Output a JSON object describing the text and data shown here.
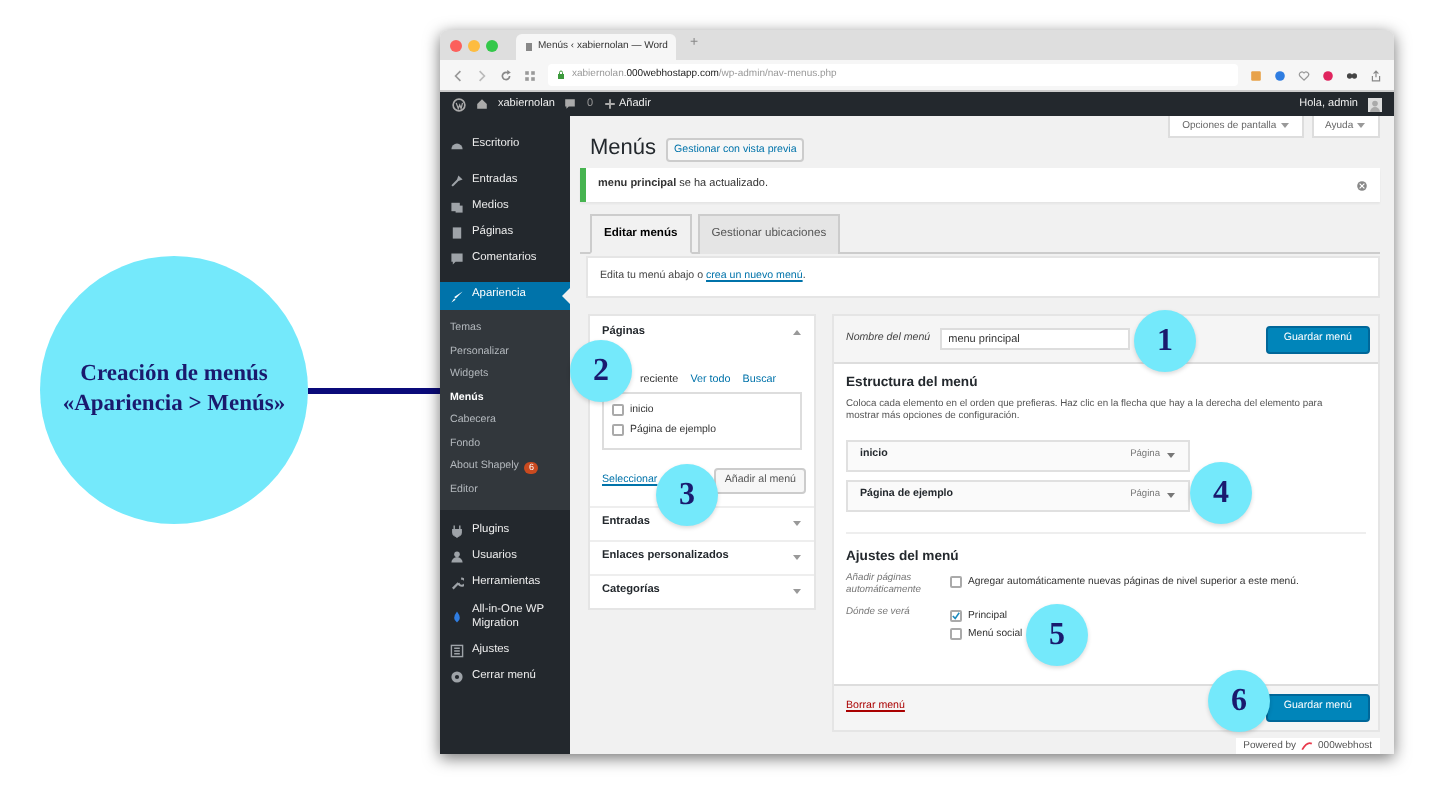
{
  "annotation": {
    "lines": [
      "Creación de menús",
      "«Apariencia > Menús»"
    ]
  },
  "callouts": [
    "1",
    "2",
    "3",
    "4",
    "5",
    "6"
  ],
  "browser": {
    "tab_title": "Menús ‹ xabiernolan — Word",
    "new_tab": "+",
    "url": "xabiernolan.**000webhostapp.com**/wp-admin/nav-menus.php"
  },
  "admin_bar": {
    "site": "xabiernolan",
    "comments": "0",
    "new": "Añadir",
    "greeting": "Hola, admin"
  },
  "sidebar": {
    "items": [
      {
        "label": "Escritorio",
        "selected": false
      },
      {
        "label": "Entradas",
        "selected": false
      },
      {
        "label": "Medios",
        "selected": false
      },
      {
        "label": "Páginas",
        "selected": false
      },
      {
        "label": "Comentarios",
        "selected": false
      },
      {
        "label": "Apariencia",
        "selected": true,
        "children": [
          {
            "label": "Temas",
            "selected": false
          },
          {
            "label": "Personalizar",
            "selected": false
          },
          {
            "label": "Widgets",
            "selected": false
          },
          {
            "label": "Menús",
            "selected": true
          },
          {
            "label": "Cabecera",
            "selected": false
          },
          {
            "label": "Fondo",
            "selected": false
          },
          {
            "label": "About Shapely",
            "selected": false,
            "badge": "6"
          },
          {
            "label": "Editor",
            "selected": false
          }
        ]
      },
      {
        "label": "Plugins",
        "selected": false
      },
      {
        "label": "Usuarios",
        "selected": false
      },
      {
        "label": "Herramientas",
        "selected": false
      },
      {
        "label": "All-in-One WP Migration",
        "selected": false
      },
      {
        "label": "Ajustes",
        "selected": false
      },
      {
        "label": "Cerrar menú",
        "selected": false
      }
    ]
  },
  "header": {
    "title": "Menús",
    "preview_button": "Gestionar con vista previa",
    "screen_options": "Opciones de pantalla",
    "help": "Ayuda"
  },
  "notice": "**menu principal** se ha actualizado.",
  "tabs": [
    {
      "label": "Editar menús",
      "selected": true
    },
    {
      "label": "Gestionar ubicaciones",
      "selected": false
    }
  ],
  "instructions": {
    "text": "Edita tu menú abajo o ",
    "link": "crea un nuevo menú",
    "end": "."
  },
  "add_items": {
    "sections": [
      {
        "title": "Páginas",
        "expanded": true,
        "tabs": [
          {
            "label": "reciente",
            "selected": true
          },
          {
            "label": "Ver todo",
            "selected": false
          },
          {
            "label": "Buscar",
            "selected": false
          }
        ],
        "items": [
          {
            "label": "inicio",
            "checked": false
          },
          {
            "label": "Página de ejemplo",
            "checked": false
          }
        ],
        "select_all": "Seleccionar",
        "add_button": "Añadir al menú"
      },
      {
        "title": "Entradas",
        "expanded": false
      },
      {
        "title": "Enlaces personalizados",
        "expanded": false
      },
      {
        "title": "Categorías",
        "expanded": false
      }
    ]
  },
  "menu_editor": {
    "name_label": "Nombre del menú",
    "name_value": "menu principal",
    "save_button": "Guardar menú",
    "structure_title": "Estructura del menú",
    "structure_text": "Coloca cada elemento en el orden que prefieras. Haz clic en la flecha que hay a la derecha del elemento para mostrar más opciones de configuración.",
    "menu_items": [
      {
        "label": "inicio",
        "type": "Página"
      },
      {
        "label": "Página de ejemplo",
        "type": "Página"
      }
    ],
    "settings_title": "Ajustes del menú",
    "settings": [
      {
        "label": "Añadir páginas automáticamente",
        "options": [
          {
            "label": "Agregar automáticamente nuevas páginas de nivel superior a este menú.",
            "checked": false
          }
        ]
      },
      {
        "label": "Dónde se verá",
        "options": [
          {
            "label": "Principal",
            "checked": true
          },
          {
            "label": "Menú social",
            "checked": false
          }
        ]
      }
    ],
    "delete_link": "Borrar menú",
    "footer_save_button": "Guardar menú"
  },
  "powered_by": {
    "text": "Powered by",
    "brand": "000webhost"
  }
}
